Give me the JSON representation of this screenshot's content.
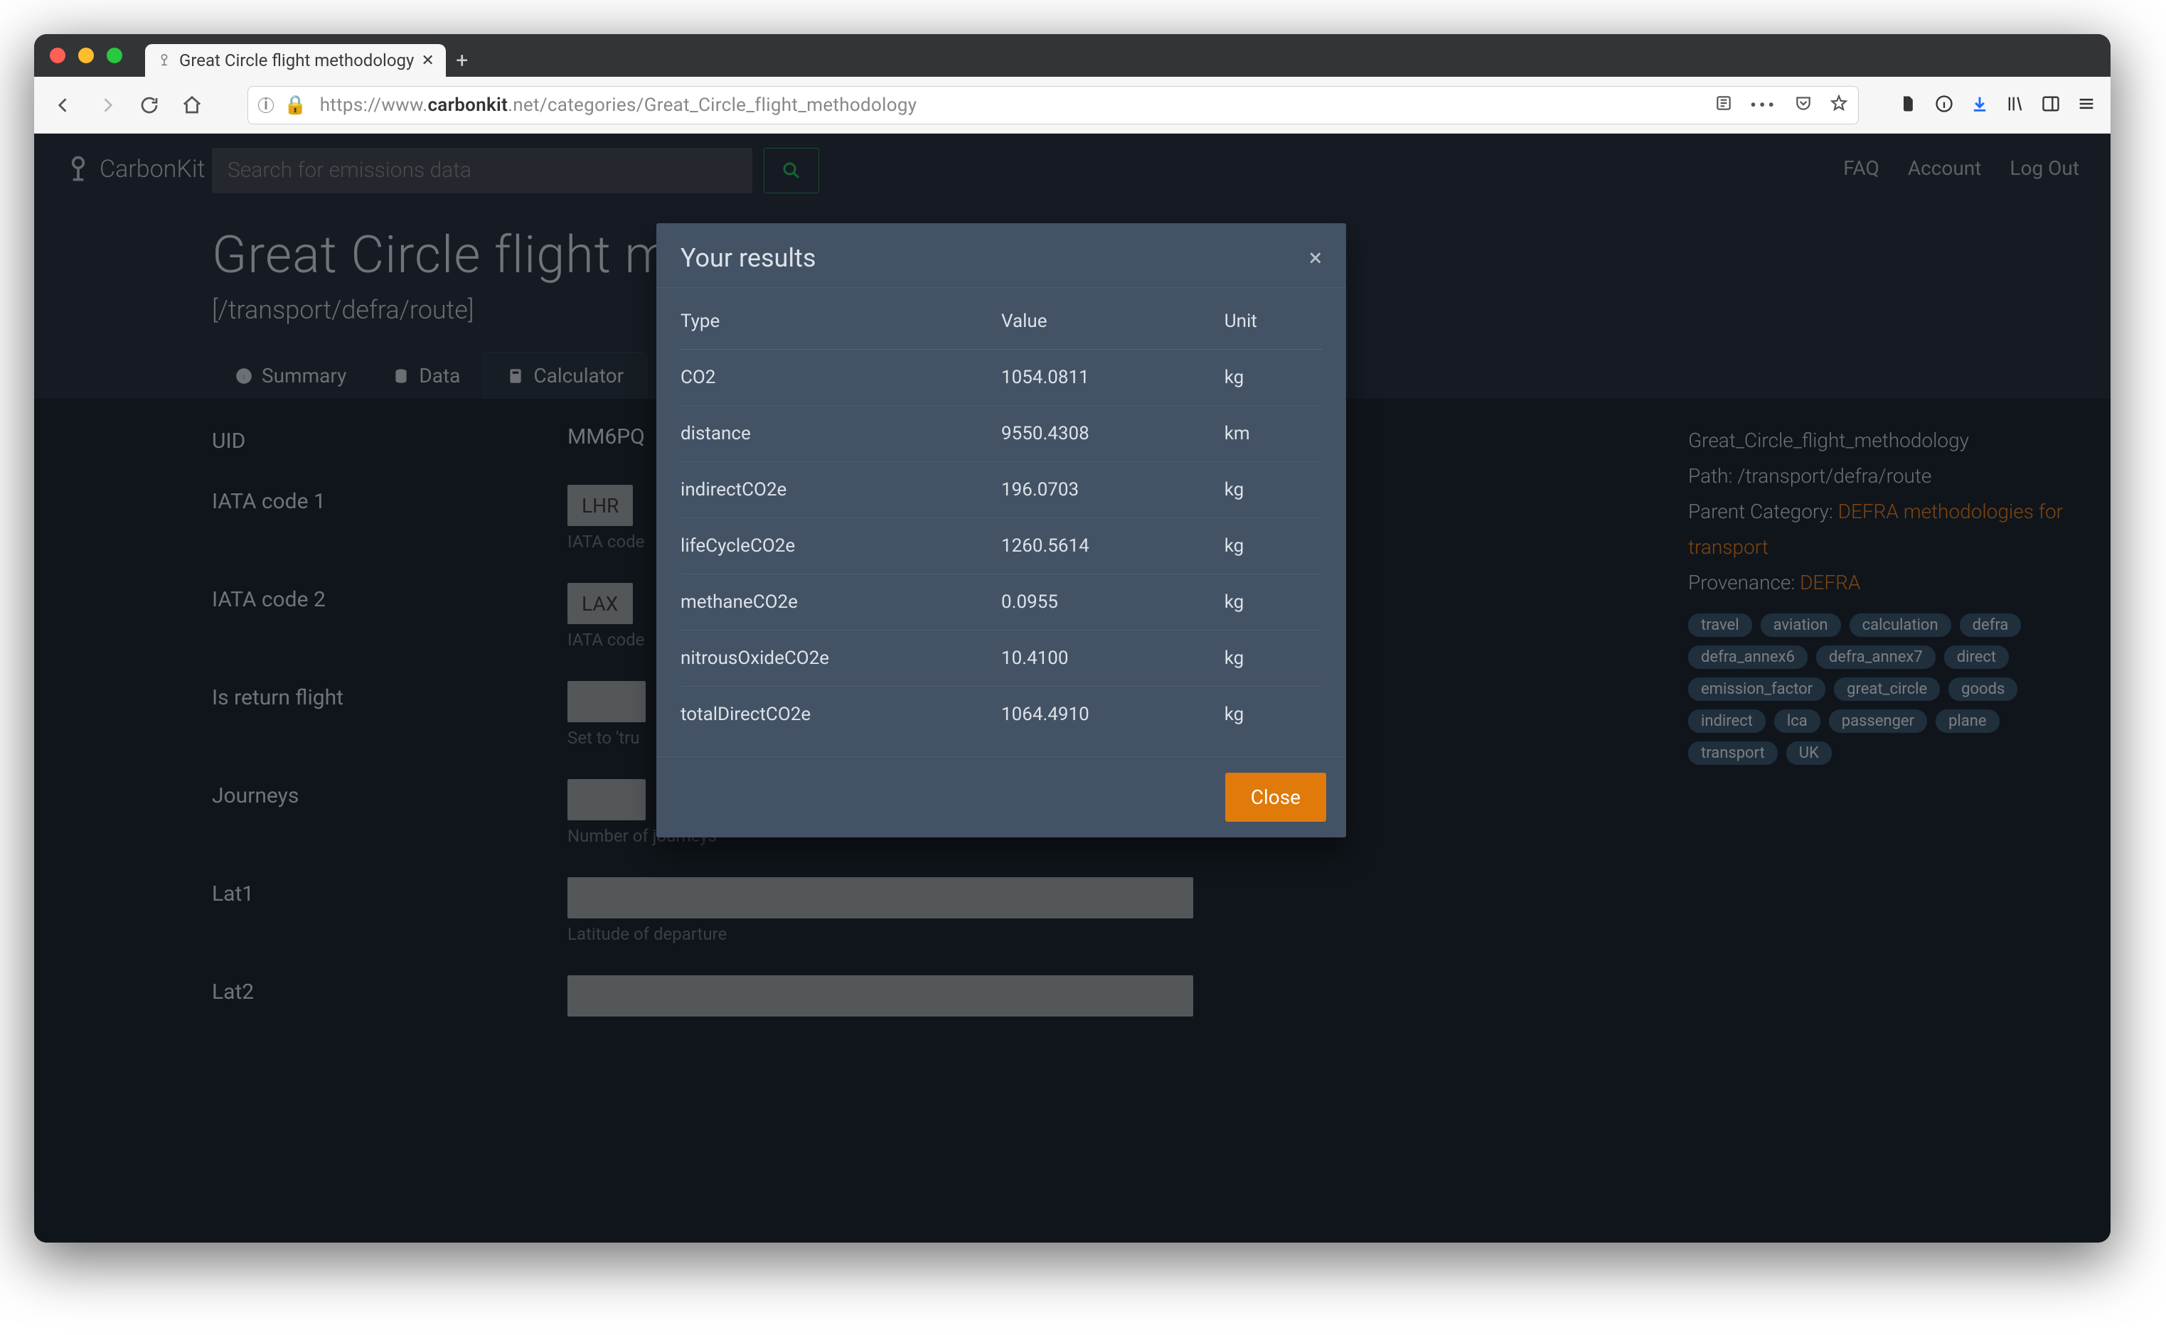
{
  "browser": {
    "tab_title": "Great Circle flight methodology",
    "url_plain": "https://www.carbonkit.net/categories/Great_Circle_flight_methodology",
    "url_prefix": "https://www.",
    "url_host": "carbonkit",
    "url_host2": ".net",
    "url_path": "/categories/Great_Circle_flight_methodology"
  },
  "nav": {
    "brand": "CarbonKit",
    "search_placeholder": "Search for emissions data",
    "links": [
      "FAQ",
      "Account",
      "Log Out"
    ]
  },
  "page": {
    "title": "Great Circle flight methodology",
    "path": "[/transport/defra/route]",
    "tabs": [
      "Summary",
      "Data",
      "Calculator"
    ],
    "uid_label": "UID",
    "uid_value": "MM6PQ",
    "fields": [
      {
        "label": "IATA code 1",
        "value": "LHR",
        "hint": "IATA code"
      },
      {
        "label": "IATA code 2",
        "value": "LAX",
        "hint": "IATA code"
      },
      {
        "label": "Is return flight",
        "value": "",
        "hint": "Set to 'tru"
      },
      {
        "label": "Journeys",
        "value": "",
        "hint": "Number of journeys"
      },
      {
        "label": "Lat1",
        "value": "",
        "hint": "Latitude of departure"
      },
      {
        "label": "Lat2",
        "value": "",
        "hint": ""
      }
    ]
  },
  "side": {
    "name_val": "Great_Circle_flight_methodology",
    "path_label": "Path: ",
    "path_val": "/transport/defra/route",
    "parent_label": "Parent Category: ",
    "parent_link": "DEFRA methodologies for transport",
    "prov_label": "Provenance: ",
    "prov_link": "DEFRA",
    "tags": [
      "travel",
      "aviation",
      "calculation",
      "defra",
      "defra_annex6",
      "defra_annex7",
      "direct",
      "emission_factor",
      "great_circle",
      "goods",
      "indirect",
      "lca",
      "passenger",
      "plane",
      "transport",
      "UK"
    ]
  },
  "modal": {
    "title": "Your results",
    "headers": [
      "Type",
      "Value",
      "Unit"
    ],
    "rows": [
      {
        "t": "CO2",
        "v": "1054.0811",
        "u": "kg"
      },
      {
        "t": "distance",
        "v": "9550.4308",
        "u": "km"
      },
      {
        "t": "indirectCO2e",
        "v": "196.0703",
        "u": "kg"
      },
      {
        "t": "lifeCycleCO2e",
        "v": "1260.5614",
        "u": "kg"
      },
      {
        "t": "methaneCO2e",
        "v": "0.0955",
        "u": "kg"
      },
      {
        "t": "nitrousOxideCO2e",
        "v": "10.4100",
        "u": "kg"
      },
      {
        "t": "totalDirectCO2e",
        "v": "1064.4910",
        "u": "kg"
      }
    ],
    "close": "Close"
  }
}
